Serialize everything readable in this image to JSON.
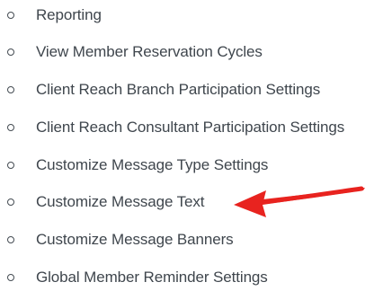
{
  "settings_list": {
    "items": [
      {
        "label": "Reporting"
      },
      {
        "label": "View Member Reservation Cycles"
      },
      {
        "label": "Client Reach Branch Participation Settings"
      },
      {
        "label": "Client Reach Consultant Participation Settings"
      },
      {
        "label": "Customize Message Type Settings"
      },
      {
        "label": "Customize Message Text"
      },
      {
        "label": "Customize Message Banners"
      },
      {
        "label": "Global Member Reminder Settings"
      }
    ],
    "bullet_icon": "circle-bullet-icon"
  },
  "annotation": {
    "icon": "red-arrow-icon",
    "color": "#e8231f",
    "points_to": "Customize Message Text"
  },
  "colors": {
    "text": "#3f464d",
    "bullet": "#444b52",
    "background": "#ffffff"
  }
}
